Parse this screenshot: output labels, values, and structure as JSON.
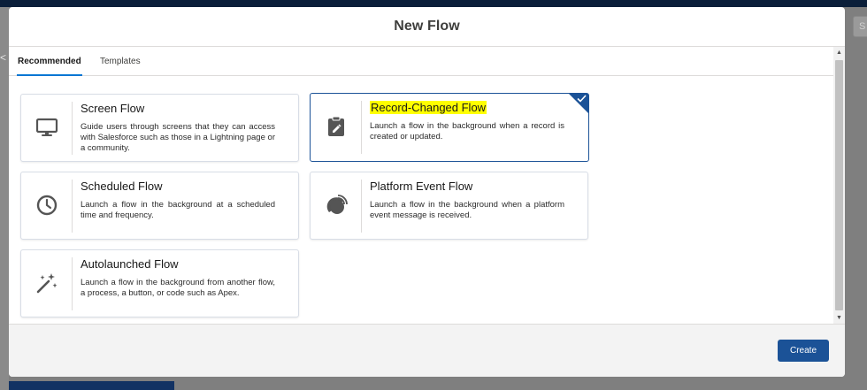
{
  "modal": {
    "title": "New Flow",
    "create_label": "Create"
  },
  "tabs": [
    {
      "label": "Recommended",
      "active": true
    },
    {
      "label": "Templates",
      "active": false
    }
  ],
  "cards": [
    {
      "title": "Screen Flow",
      "icon": "desktop-icon",
      "description": "Guide users through screens that they can access with Salesforce such as those in a Lightning page or a community.",
      "selected": false
    },
    {
      "title": "Record-Changed Flow",
      "icon": "clipboard-edit-icon",
      "description": "Launch a flow in the background when a record is created or updated.",
      "selected": true
    },
    {
      "title": "Scheduled Flow",
      "icon": "clock-icon",
      "description": "Launch a flow in the background at a scheduled time and frequency.",
      "selected": false
    },
    {
      "title": "Platform Event Flow",
      "icon": "broadcast-icon",
      "description": "Launch a flow in the background when a platform event message is received.",
      "selected": false
    },
    {
      "title": "Autolaunched Flow",
      "icon": "magic-wand-icon",
      "description": "Launch a flow in the background from another flow, a process, a button, or code such as Apex.",
      "selected": false
    }
  ],
  "background": {
    "chevron": "<",
    "right_button": "S"
  },
  "colors": {
    "accent": "#1b5297",
    "tab_underline": "#0176d3",
    "highlight": "#ffff00"
  }
}
